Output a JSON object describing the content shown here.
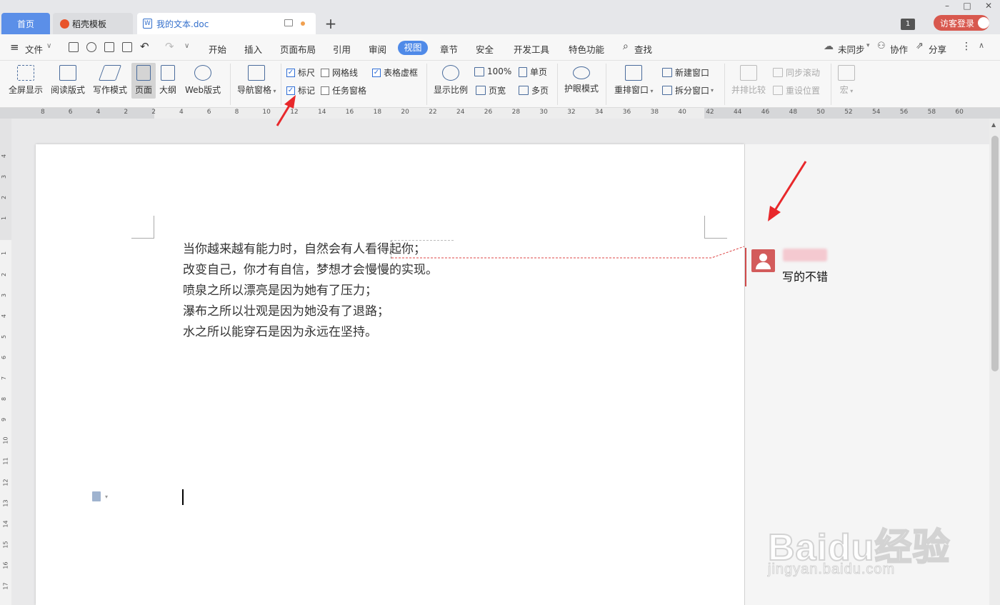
{
  "tabs": [
    {
      "label": "首页"
    },
    {
      "label": "稻壳模板"
    },
    {
      "label": "我的文本.doc"
    }
  ],
  "header": {
    "badge_count": "1",
    "login_label": "访客登录"
  },
  "menu": {
    "file": "文件",
    "items": [
      "开始",
      "插入",
      "页面布局",
      "引用",
      "审阅",
      "视图",
      "章节",
      "安全",
      "开发工具",
      "特色功能"
    ],
    "search": "查找",
    "sync": "未同步",
    "collab": "协作",
    "share": "分享"
  },
  "ribbon": {
    "view_modes": [
      "全屏显示",
      "阅读版式",
      "写作模式",
      "页面",
      "大纲",
      "Web版式"
    ],
    "nav_pane": "导航窗格",
    "checkboxes": [
      {
        "label": "标尺",
        "checked": true
      },
      {
        "label": "网格线",
        "checked": false
      },
      {
        "label": "表格虚框",
        "checked": true
      },
      {
        "label": "标记",
        "checked": true
      },
      {
        "label": "任务窗格",
        "checked": false
      }
    ],
    "zoom": {
      "ratio": "显示比例",
      "hundred": "100%",
      "page_width": "页宽",
      "single": "单页",
      "multi": "多页"
    },
    "eye": "护眼模式",
    "rearrange": "重排窗口",
    "new_window": "新建窗口",
    "split_window": "拆分窗口",
    "compare": "并排比较",
    "sync_scroll": "同步滚动",
    "reset_pos": "重设位置",
    "macro": "宏"
  },
  "ruler_numbers": [
    "8",
    "6",
    "4",
    "2",
    "2",
    "4",
    "6",
    "8",
    "10",
    "12",
    "14",
    "16",
    "18",
    "20",
    "22",
    "24",
    "26",
    "28",
    "30",
    "32",
    "34",
    "36",
    "38",
    "40",
    "42",
    "44",
    "46",
    "48",
    "50",
    "52",
    "54",
    "56",
    "58",
    "60"
  ],
  "vruler_numbers": [
    "4",
    "3",
    "2",
    "1",
    "1",
    "2",
    "3",
    "4",
    "5",
    "6",
    "7",
    "8",
    "9",
    "10",
    "11",
    "12",
    "13",
    "14",
    "15",
    "16",
    "17"
  ],
  "document": {
    "lines": [
      "当你越来越有能力时，自然会有人看得起你；",
      "改变自己，你才有自信，梦想才会慢慢的实现。",
      "喷泉之所以漂亮是因为她有了压力；",
      "瀑布之所以壮观是因为她没有了退路；",
      "水之所以能穿石是因为永远在坚持。"
    ]
  },
  "comment": {
    "text": "写的不错"
  },
  "watermark": {
    "brand": "Baidu经验",
    "url": "jingyan.baidu.com"
  },
  "colors": {
    "accent": "#4f8ae8",
    "annotation_red": "#e8282b",
    "comment_red": "#d35b5b"
  }
}
